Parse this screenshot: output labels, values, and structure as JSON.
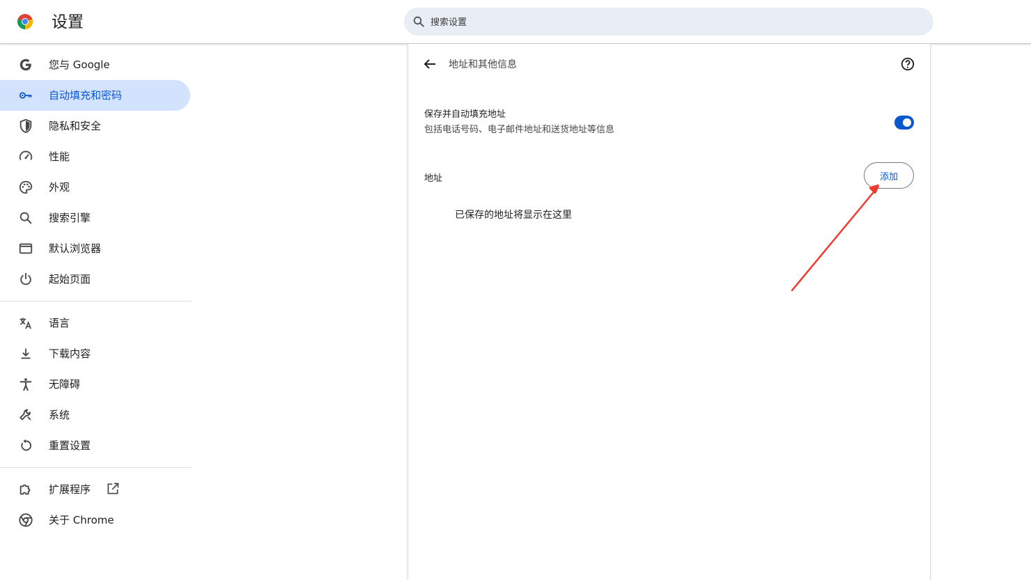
{
  "header": {
    "title": "设置",
    "search_placeholder": "搜索设置"
  },
  "sidebar": {
    "items": [
      {
        "label": "您与 Google",
        "icon": "google-g-icon"
      },
      {
        "label": "自动填充和密码",
        "icon": "key-icon",
        "active": true
      },
      {
        "label": "隐私和安全",
        "icon": "shield-icon"
      },
      {
        "label": "性能",
        "icon": "speedometer-icon"
      },
      {
        "label": "外观",
        "icon": "palette-icon"
      },
      {
        "label": "搜索引擎",
        "icon": "search-icon"
      },
      {
        "label": "默认浏览器",
        "icon": "browser-window-icon"
      },
      {
        "label": "起始页面",
        "icon": "power-icon"
      },
      {
        "label": "语言",
        "icon": "translate-icon"
      },
      {
        "label": "下载内容",
        "icon": "download-icon"
      },
      {
        "label": "无障碍",
        "icon": "accessibility-icon"
      },
      {
        "label": "系统",
        "icon": "wrench-icon"
      },
      {
        "label": "重置设置",
        "icon": "reset-icon"
      },
      {
        "label": "扩展程序",
        "icon": "puzzle-icon"
      },
      {
        "label": "关于 Chrome",
        "icon": "chrome-icon"
      }
    ]
  },
  "main": {
    "title": "地址和其他信息",
    "setting": {
      "title": "保存并自动填充地址",
      "subtitle": "包括电话号码、电子邮件地址和送货地址等信息",
      "enabled": true
    },
    "section_label": "地址",
    "add_button": "添加",
    "empty_message": "已保存的地址将显示在这里"
  },
  "colors": {
    "accent": "#0b57d0",
    "active_bg": "#d3e3fd",
    "search_bg": "#e9eef6",
    "annotation_arrow": "#f03a2e"
  }
}
